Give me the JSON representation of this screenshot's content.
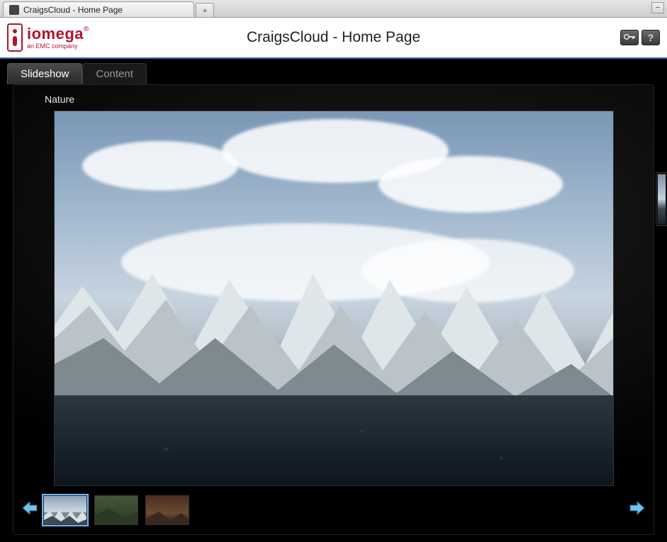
{
  "browser": {
    "tab_title": "CraigsCloud - Home Page",
    "newtab_glyph": "+",
    "minimize_glyph": "–"
  },
  "header": {
    "brand": "iomega",
    "brand_suffix": "®",
    "tagline": "an EMC company",
    "page_title": "CraigsCloud - Home Page",
    "key_icon": "key-icon",
    "help_glyph": "?"
  },
  "view_tabs": {
    "slideshow": "Slideshow",
    "content": "Content",
    "active": "slideshow"
  },
  "gallery": {
    "album_title": "Nature",
    "thumbnails": [
      {
        "name": "thumb-mountains",
        "selected": true
      },
      {
        "name": "thumb-forest",
        "selected": false
      },
      {
        "name": "thumb-desert",
        "selected": false
      }
    ],
    "prev_icon": "arrow-left-icon",
    "next_icon": "arrow-right-icon"
  }
}
